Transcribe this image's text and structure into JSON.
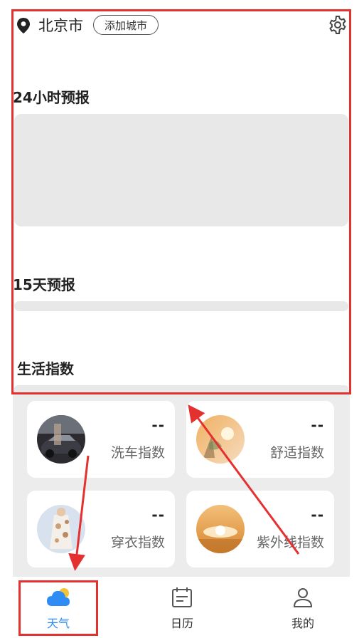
{
  "header": {
    "city": "北京市",
    "add_city_label": "添加城市"
  },
  "sections": {
    "hourly_title": "24小时预报",
    "daily_title": "15天预报",
    "life_title": "生活指数"
  },
  "life_index": [
    {
      "label": "洗车指数",
      "value": "--"
    },
    {
      "label": "舒适指数",
      "value": "--"
    },
    {
      "label": "穿衣指数",
      "value": "--"
    },
    {
      "label": "紫外线指数",
      "value": "--"
    }
  ],
  "tabs": [
    {
      "label": "天气",
      "icon": "cloud-icon",
      "active": true
    },
    {
      "label": "日历",
      "icon": "calendar-icon",
      "active": false
    },
    {
      "label": "我的",
      "icon": "user-icon",
      "active": false
    }
  ],
  "colors": {
    "accent": "#2f8cf5",
    "annotation": "#e53030",
    "muted": "#666666"
  }
}
